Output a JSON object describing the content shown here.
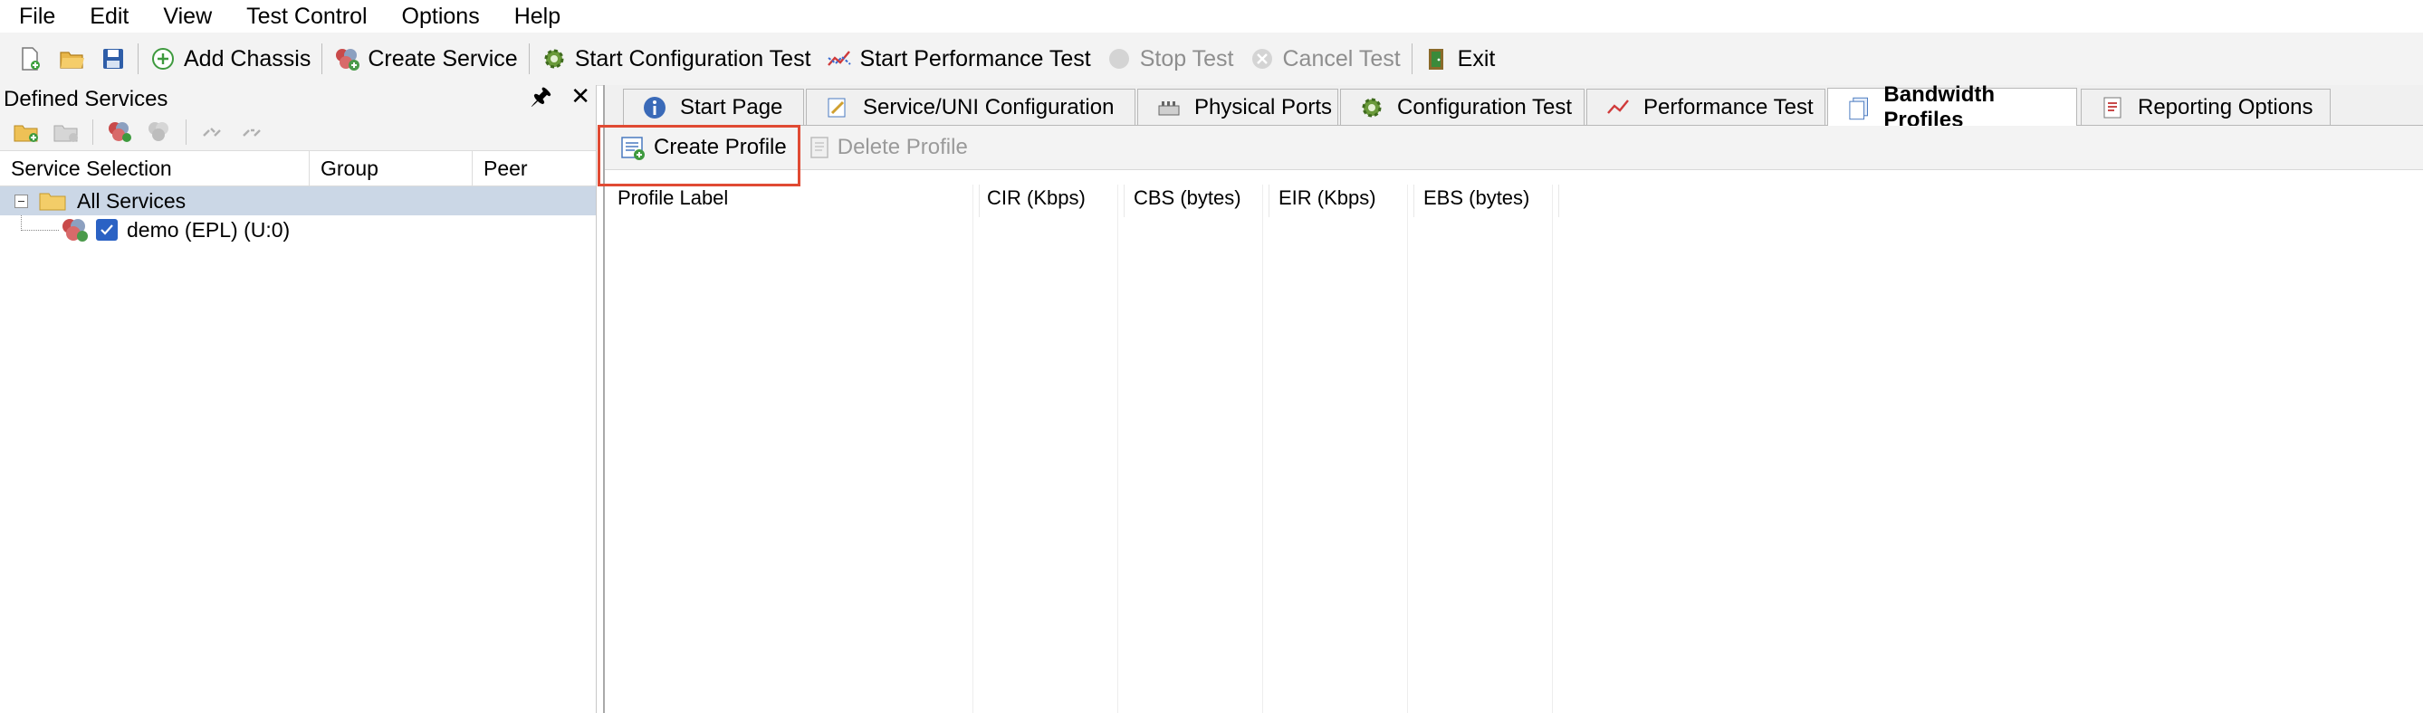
{
  "menu": [
    "File",
    "Edit",
    "View",
    "Test Control",
    "Options",
    "Help"
  ],
  "toolbar": {
    "add_chassis": "Add Chassis",
    "create_service": "Create Service",
    "start_config_test": "Start Configuration Test",
    "start_perf_test": "Start Performance Test",
    "stop_test": "Stop Test",
    "cancel_test": "Cancel Test",
    "exit": "Exit"
  },
  "left_panel": {
    "title": "Defined Services",
    "columns": [
      "Service Selection",
      "Group",
      "Peer"
    ],
    "tree": {
      "root": "All Services",
      "children": [
        "demo (EPL) (U:0)"
      ]
    }
  },
  "tabs": [
    "Start Page",
    "Service/UNI Configuration",
    "Physical Ports",
    "Configuration Test",
    "Performance Test",
    "Bandwidth Profiles",
    "Reporting Options"
  ],
  "active_tab": "Bandwidth Profiles",
  "profiles": {
    "create_label": "Create Profile",
    "delete_label": "Delete Profile",
    "columns": [
      "Profile Label",
      "CIR (Kbps)",
      "CBS (bytes)",
      "EIR (Kbps)",
      "EBS (bytes)"
    ]
  },
  "colors": {
    "highlight": "#e04a33",
    "selection": "#cbd7e6",
    "checkbox": "#2b62c4"
  }
}
